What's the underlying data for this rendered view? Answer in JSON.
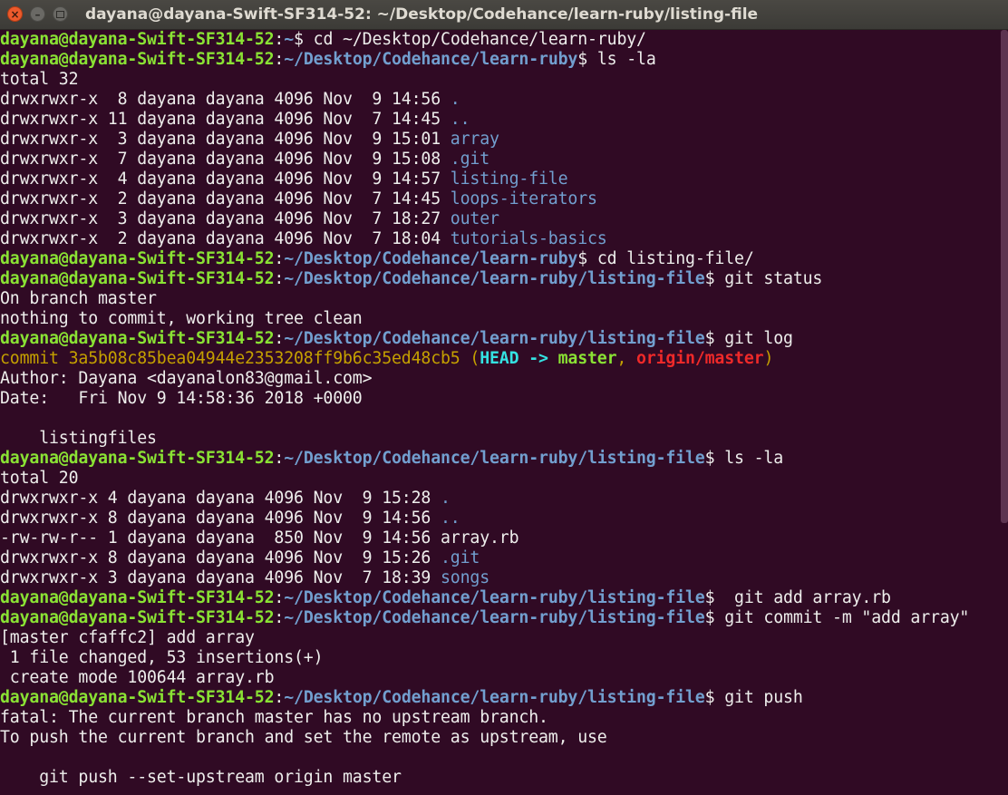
{
  "window": {
    "title": "dayana@dayana-Swift-SF314-52: ~/Desktop/Codehance/learn-ruby/listing-file",
    "close_glyph": "×",
    "min_glyph": "–"
  },
  "prompt": {
    "user": "dayana@dayana-Swift-SF314-52",
    "sep": ":",
    "dollar": "$"
  },
  "lines": [
    {
      "type": "prompt",
      "path": "~",
      "cmd": " cd ~/Desktop/Codehance/learn-ruby/"
    },
    {
      "type": "prompt",
      "path": "~/Desktop/Codehance/learn-ruby",
      "cmd": " ls -la"
    },
    {
      "type": "text",
      "text": "total 32"
    },
    {
      "type": "entry",
      "meta": "drwxrwxr-x  8 dayana dayana 4096 Nov  9 14:56 ",
      "name": "."
    },
    {
      "type": "entry",
      "meta": "drwxrwxr-x 11 dayana dayana 4096 Nov  7 14:45 ",
      "name": ".."
    },
    {
      "type": "entry",
      "meta": "drwxrwxr-x  3 dayana dayana 4096 Nov  9 15:01 ",
      "name": "array"
    },
    {
      "type": "entry",
      "meta": "drwxrwxr-x  7 dayana dayana 4096 Nov  9 15:08 ",
      "name": ".git"
    },
    {
      "type": "entry",
      "meta": "drwxrwxr-x  4 dayana dayana 4096 Nov  9 14:57 ",
      "name": "listing-file"
    },
    {
      "type": "entry",
      "meta": "drwxrwxr-x  2 dayana dayana 4096 Nov  7 14:45 ",
      "name": "loops-iterators"
    },
    {
      "type": "entry",
      "meta": "drwxrwxr-x  3 dayana dayana 4096 Nov  7 18:27 ",
      "name": "outer"
    },
    {
      "type": "entry",
      "meta": "drwxrwxr-x  2 dayana dayana 4096 Nov  7 18:04 ",
      "name": "tutorials-basics"
    },
    {
      "type": "prompt",
      "path": "~/Desktop/Codehance/learn-ruby",
      "cmd": " cd listing-file/"
    },
    {
      "type": "prompt",
      "path": "~/Desktop/Codehance/learn-ruby/listing-file",
      "cmd": " git status"
    },
    {
      "type": "text",
      "text": "On branch master"
    },
    {
      "type": "text",
      "text": "nothing to commit, working tree clean"
    },
    {
      "type": "prompt",
      "path": "~/Desktop/Codehance/learn-ruby/listing-file",
      "cmd": " git log"
    },
    {
      "type": "commit",
      "prefix": "commit 3a5b08c85bea04944e2353208ff9b6c35ed48cb5 (",
      "head": "HEAD -> ",
      "master": "master",
      "comma": ", ",
      "origin": "origin/master",
      "suffix": ")"
    },
    {
      "type": "text",
      "text": "Author: Dayana <dayanalon83@gmail.com>"
    },
    {
      "type": "text",
      "text": "Date:   Fri Nov 9 14:58:36 2018 +0000"
    },
    {
      "type": "text",
      "text": ""
    },
    {
      "type": "text",
      "text": "    listingfiles"
    },
    {
      "type": "prompt",
      "path": "~/Desktop/Codehance/learn-ruby/listing-file",
      "cmd": " ls -la"
    },
    {
      "type": "text",
      "text": "total 20"
    },
    {
      "type": "entry",
      "meta": "drwxrwxr-x 4 dayana dayana 4096 Nov  9 15:28 ",
      "name": "."
    },
    {
      "type": "entry",
      "meta": "drwxrwxr-x 8 dayana dayana 4096 Nov  9 14:56 ",
      "name": ".."
    },
    {
      "type": "text",
      "text": "-rw-rw-r-- 1 dayana dayana  850 Nov  9 14:56 array.rb"
    },
    {
      "type": "entry",
      "meta": "drwxrwxr-x 8 dayana dayana 4096 Nov  9 15:26 ",
      "name": ".git"
    },
    {
      "type": "entry",
      "meta": "drwxrwxr-x 3 dayana dayana 4096 Nov  7 18:39 ",
      "name": "songs"
    },
    {
      "type": "prompt",
      "path": "~/Desktop/Codehance/learn-ruby/listing-file",
      "cmd": "  git add array.rb"
    },
    {
      "type": "prompt",
      "path": "~/Desktop/Codehance/learn-ruby/listing-file",
      "cmd": " git commit -m \"add array\""
    },
    {
      "type": "text",
      "text": "[master cfaffc2] add array"
    },
    {
      "type": "text",
      "text": " 1 file changed, 53 insertions(+)"
    },
    {
      "type": "text",
      "text": " create mode 100644 array.rb"
    },
    {
      "type": "prompt",
      "path": "~/Desktop/Codehance/learn-ruby/listing-file",
      "cmd": " git push"
    },
    {
      "type": "text",
      "text": "fatal: The current branch master has no upstream branch."
    },
    {
      "type": "text",
      "text": "To push the current branch and set the remote as upstream, use"
    },
    {
      "type": "text",
      "text": ""
    },
    {
      "type": "text",
      "text": "    git push --set-upstream origin master"
    }
  ],
  "colors": {
    "background": "#300a24",
    "user": "#8ae234",
    "path": "#729fcf",
    "commit": "#c4a000",
    "head": "#34e2e2",
    "origin": "#ef2929"
  }
}
